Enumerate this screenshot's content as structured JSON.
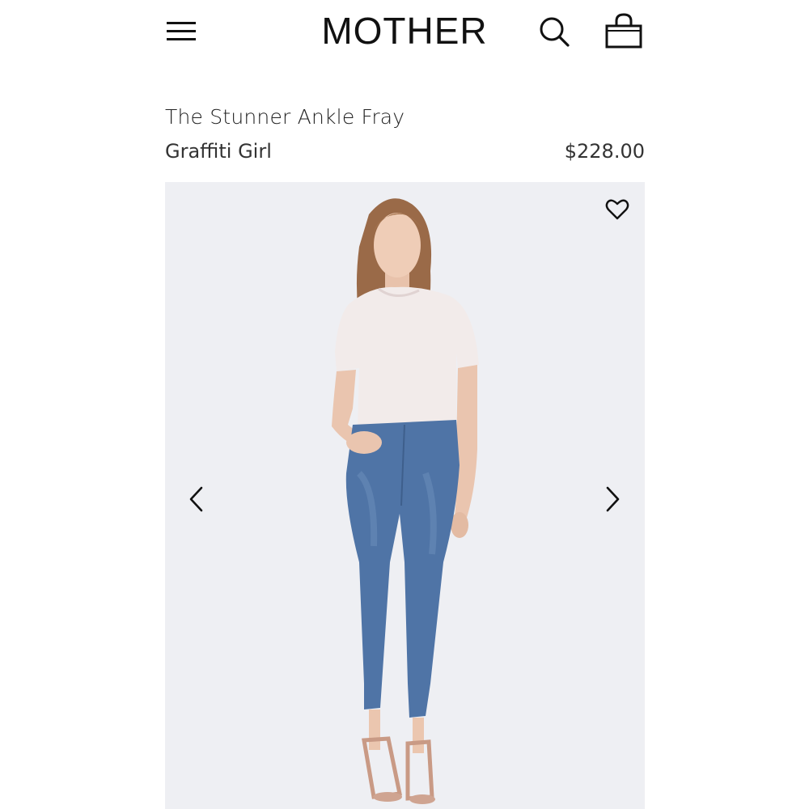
{
  "header": {
    "brand": "MOTHER",
    "menu_icon": "hamburger-menu-icon",
    "search_icon": "search-icon",
    "cart_icon": "shopping-bag-icon"
  },
  "product": {
    "name": "The Stunner Ankle Fray",
    "color": "Graffiti Girl",
    "price": "$228.00"
  },
  "gallery": {
    "wishlist_icon": "heart-icon",
    "prev_icon": "chevron-left-icon",
    "next_icon": "chevron-right-icon",
    "image": "product-photo-model-in-white-tee-and-skinny-jeans"
  },
  "colors": {
    "text": "#1a1a1a",
    "image_bg": "#eeeff3",
    "denim": "#4f74a6"
  }
}
